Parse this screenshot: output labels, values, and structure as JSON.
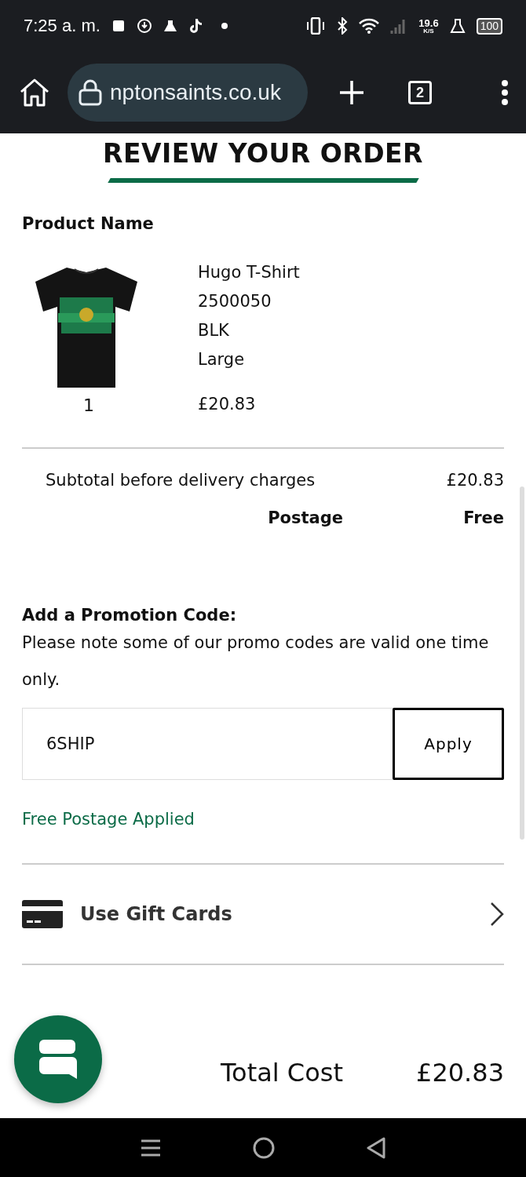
{
  "status_bar": {
    "time": "7:25 a. m.",
    "net_speed": "19.6",
    "net_unit": "K/S",
    "battery": "100"
  },
  "browser": {
    "url": "nptonsaints.co.uk",
    "tab_count": "2"
  },
  "page": {
    "title": "REVIEW YOUR ORDER",
    "product_heading": "Product Name",
    "product": {
      "quantity": "1",
      "name": "Hugo T-Shirt",
      "code": "2500050",
      "colour": "BLK",
      "size": "Large",
      "price": "£20.83"
    },
    "summary": [
      {
        "label": "Subtotal before delivery charges",
        "value": "£20.83",
        "bold": false
      },
      {
        "label": "Postage",
        "value": "Free",
        "bold": true
      }
    ],
    "promo": {
      "heading": "Add a Promotion Code:",
      "note": "Please note some of our promo codes are valid one time only.",
      "value": "6SHIP",
      "button": "Apply",
      "message": "Free Postage Applied"
    },
    "gift_cards": {
      "label": "Use Gift Cards"
    },
    "total": {
      "label": "Total Cost",
      "value": "£20.83"
    }
  }
}
